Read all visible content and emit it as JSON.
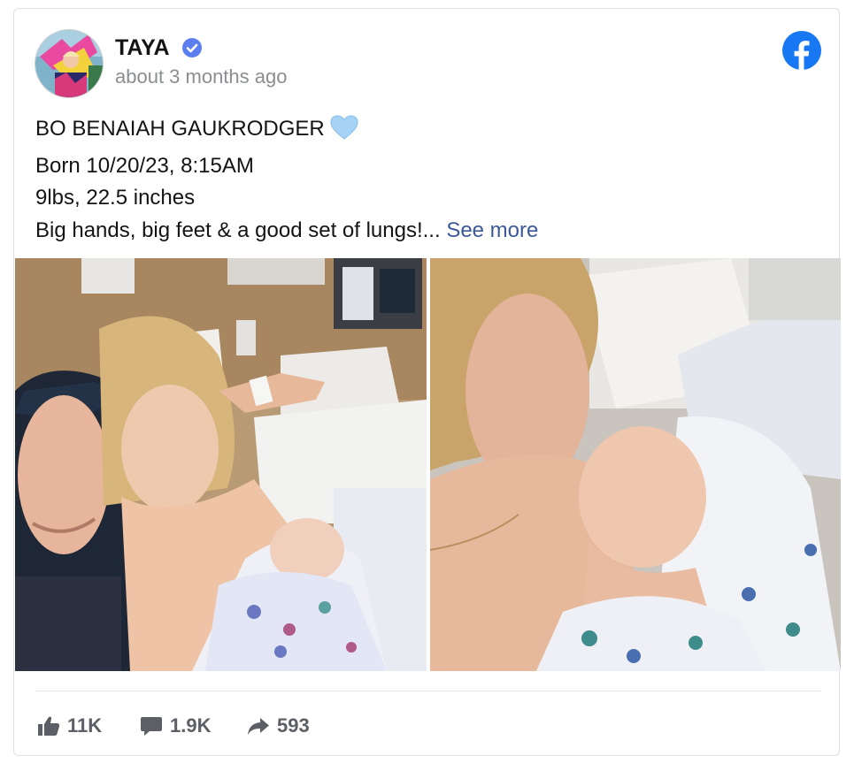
{
  "post": {
    "author": "TAYA",
    "verified": true,
    "timestamp": "about 3 months ago",
    "platform_icon": "facebook-icon",
    "caption_lines": [
      "BO BENAIAH GAUKRODGER",
      "Born 10/20/23, 8:15AM",
      "9lbs, 22.5 inches",
      "Big hands, big feet & a good set of lungs!..."
    ],
    "heart_emoji_icon": "light-blue-heart-icon",
    "see_more": "See more",
    "photos": [
      {
        "icon": "photo-parents-with-newborn-hospital-selfie"
      },
      {
        "icon": "photo-newborn-on-mothers-chest"
      }
    ]
  },
  "stats": {
    "likes": "11K",
    "comments": "1.9K",
    "shares": "593"
  },
  "colors": {
    "facebook_blue": "#1877f2",
    "verified_blue": "#5b7ff0",
    "link": "#3b5998",
    "muted": "#8a8d91",
    "heart": "#a6d3f5"
  }
}
